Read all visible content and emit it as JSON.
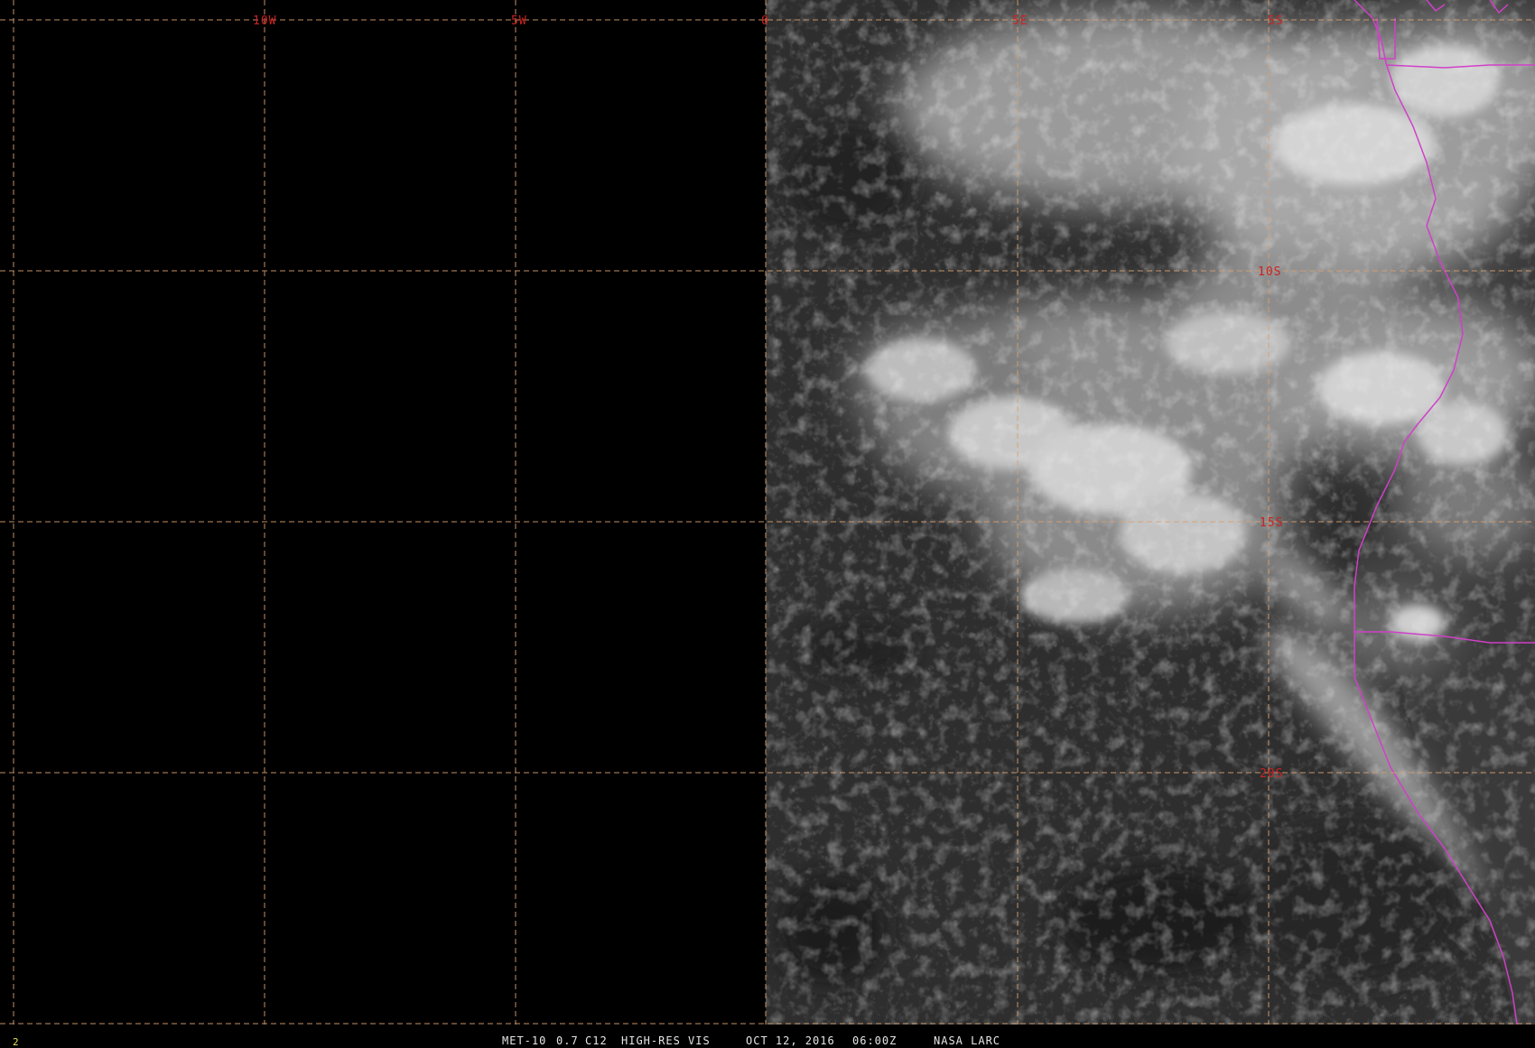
{
  "image": {
    "satellite": "MET-10",
    "channel": "0.7",
    "channel_code": "C12",
    "product": "HIGH-RES VIS",
    "date": "OCT 12, 2016",
    "time": "06:00Z",
    "source": "NASA LARC",
    "frame_index": "2"
  },
  "grid": {
    "longitude_labels": [
      "10W",
      "5W",
      "0",
      "5E",
      "5S"
    ],
    "latitude_labels": [
      "10S",
      "15S",
      "20S"
    ],
    "line_color": "#d8a070",
    "label_color": "#cc2222",
    "border_color": "#d040c8"
  },
  "colors": {
    "space_background": "#000000",
    "ocean": "#2e2e2e",
    "cloud": "#cfcfcf"
  }
}
